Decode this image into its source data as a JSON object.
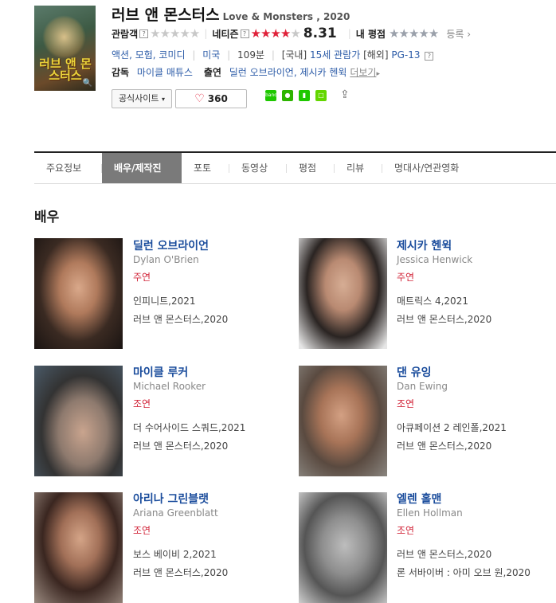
{
  "movie": {
    "poster_text": "러브 앤 몬스터스",
    "title_ko": "러브 앤 몬스터스",
    "title_en": "Love & Monsters , 2020",
    "audience_label": "관람객",
    "netizen_label": "네티즌",
    "netizen_score": "8.31",
    "my_rating_label": "내 평점",
    "register_label": "등록",
    "genres": "액션, 모험, 코미디",
    "country": "미국",
    "runtime": "109분",
    "domestic_label": "[국내]",
    "domestic_rating": "15세 관람가",
    "overseas_label": "[해외]",
    "overseas_rating": "PG-13",
    "director_label": "감독",
    "director": "마이클 매튜스",
    "cast_label": "출연",
    "cast": "딜런 오브라이언, 제시카 헨윅",
    "more_label": "더보기",
    "official_site_label": "공식사이트",
    "like_count": "360"
  },
  "tabs": [
    "주요정보",
    "배우/제작진",
    "포토",
    "동영상",
    "평점",
    "리뷰",
    "명대사/연관영화"
  ],
  "section_title": "배우",
  "actors": [
    {
      "name": "딜런 오브라이언",
      "en": "Dylan O'Brien",
      "role": "주연",
      "works": [
        "인피니트,2021",
        "러브 앤 몬스터스,2020"
      ]
    },
    {
      "name": "제시카 헨윅",
      "en": "Jessica Henwick",
      "role": "주연",
      "works": [
        "매트릭스 4,2021",
        "러브 앤 몬스터스,2020"
      ]
    },
    {
      "name": "마이클 루커",
      "en": "Michael Rooker",
      "role": "조연",
      "works": [
        "더 수어사이드 스쿼드,2021",
        "러브 앤 몬스터스,2020"
      ]
    },
    {
      "name": "댄 유잉",
      "en": "Dan Ewing",
      "role": "조연",
      "works": [
        "아큐페이션 2 레인폴,2021",
        "러브 앤 몬스터스,2020"
      ]
    },
    {
      "name": "아리나 그린블랫",
      "en": "Ariana Greenblatt",
      "role": "조연",
      "works": [
        "보스 베이비 2,2021",
        "러브 앤 몬스터스,2020"
      ]
    },
    {
      "name": "엘렌 홀맨",
      "en": "Ellen Hollman",
      "role": "조연",
      "works": [
        "러브 앤 몬스터스,2020",
        "론 서바이버 : 아미 오브 원,2020"
      ]
    }
  ],
  "colors": {
    "link": "#2d5ca8",
    "role": "#d2263a",
    "star_red": "#e0223a",
    "tab_active": "#7a7a7a"
  }
}
